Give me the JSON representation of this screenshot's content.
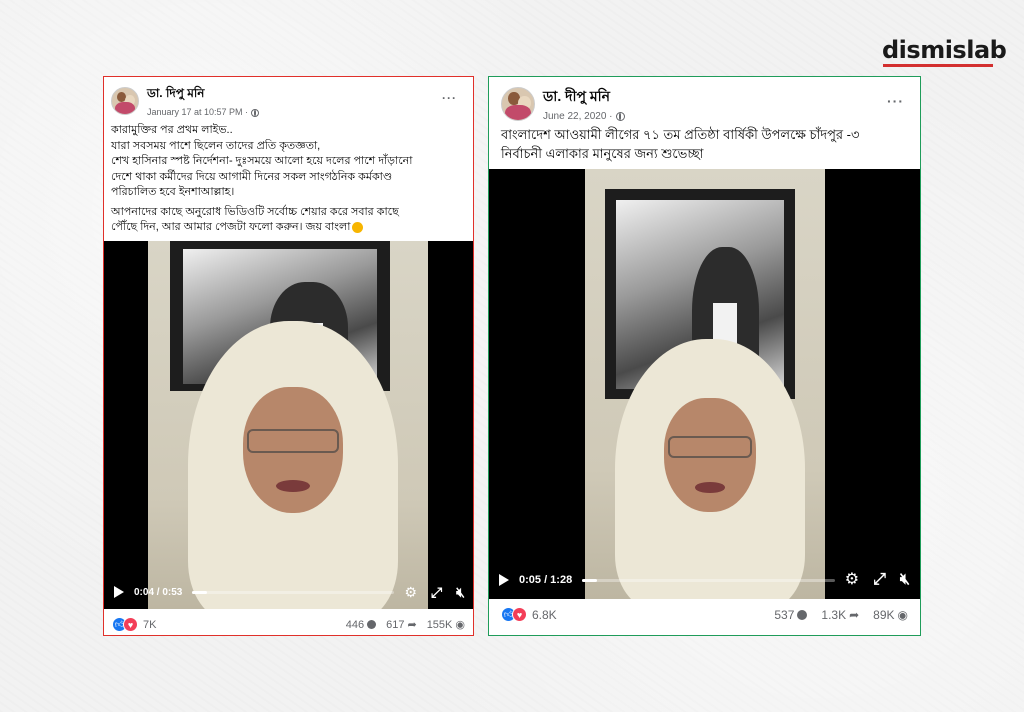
{
  "brand": {
    "name": "dismislab",
    "accent": "#d32f2f"
  },
  "posts": [
    {
      "author": "ডা. দিপু মনি",
      "date": "January 17 at 10:57 PM ·",
      "privacy_icon": "globe-icon",
      "border_color": "#e0302a",
      "caption_lines": [
        "কারামুক্তির পর প্রথম লাইভ..",
        "যারা সবসময় পাশে ছিলেন তাদের প্রতি কৃতজ্ঞতা,",
        "শেখ হাসিনার স্পষ্ট নির্দেশনা- দুঃসময়ে আলো হয়ে দলের পাশে দাঁড়ানো",
        "দেশে থাকা কর্মীদের দিয়ে আগামী দিনের সকল সাংগঠনিক কর্মকাণ্ড",
        "পরিচালিত হবে ইনশাআল্লাহ।",
        "আপনাদের কাছে অনুরোধ ভিডিওটি সর্বোচ্চ শেয়ার করে সবার কাছে",
        "পৌঁছে দিন, আর আমার পেজটা ফলো করুন। জয় বাংলা"
      ],
      "video_time": "0:04 / 0:53",
      "video_progress": 0.07,
      "reactions_count": "7K",
      "comments_count": "446",
      "shares_count": "617",
      "views_count": "155K"
    },
    {
      "author": "ডা. দীপু মনি",
      "date": "June 22, 2020 ·",
      "privacy_icon": "globe-icon",
      "border_color": "#1f9c5a",
      "caption_lines": [
        "বাংলাদেশ আওয়ামী লীগের ৭১ তম প্রতিষ্ঠা বার্ষিকী উপলক্ষে চাঁদপুর -৩",
        "নির্বাচনী এলাকার মানুষের জন্য শুভেচ্ছা"
      ],
      "video_time": "0:05 / 1:28",
      "video_progress": 0.06,
      "reactions_count": "6.8K",
      "comments_count": "537",
      "shares_count": "1.3K",
      "views_count": "89K"
    }
  ]
}
